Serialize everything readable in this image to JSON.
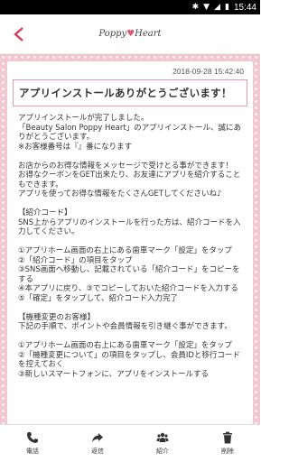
{
  "status": {
    "time": "15:44"
  },
  "app": {
    "logo_text_1": "Poppy",
    "logo_text_2": "Heart"
  },
  "message": {
    "date": "2018-09-28 15:42:40",
    "title": "アプリインストールありがとうございます！",
    "body": "アプリインストールが完了しました。\n「Beauty Salon Poppy Heart」のアプリインストール、誠にありがとうございます。\n※お客様番号は『』番になります\n\nお店からのお得な情報をメッセージで受けとる事ができます！\nお得なクーポンをGET出来たり、お友達にアプリを紹介することもできます。\nアプリを使ってお得な情報をたくさんGETしてくださいね♪\n\n【紹介コード】\nSNS上からアプリのインストールを行った方は、紹介コードを入力してください。\n\n①アプリホーム画面の右上にある歯車マーク「設定」をタップ\n②「紹介コード」の項目をタップ\n③SNS画面へ移動し、記載されている「紹介コード」をコピーをする\n④本アプリに戻り、③でコピーしておいた紹介コードを入力する\n⑤「確定」をタップして、紹介コード入力完了\n\n【機種変更のお客様】\n下記の手順で、ポイントや会員情報を引き継ぐ事ができます。\n\n①アプリホーム画面の右上にある歯車マーク「設定」をタップ\n②「機種変更について」の項目をタップし、会員IDと移行コードを控えておく\n③新しいスマートフォンに、アプリをインストールする"
  },
  "tabs": [
    {
      "label": "電話",
      "icon": "phone-icon"
    },
    {
      "label": "返信",
      "icon": "reply-icon"
    },
    {
      "label": "紹介",
      "icon": "people-icon"
    },
    {
      "label": "削除",
      "icon": "trash-icon"
    }
  ]
}
